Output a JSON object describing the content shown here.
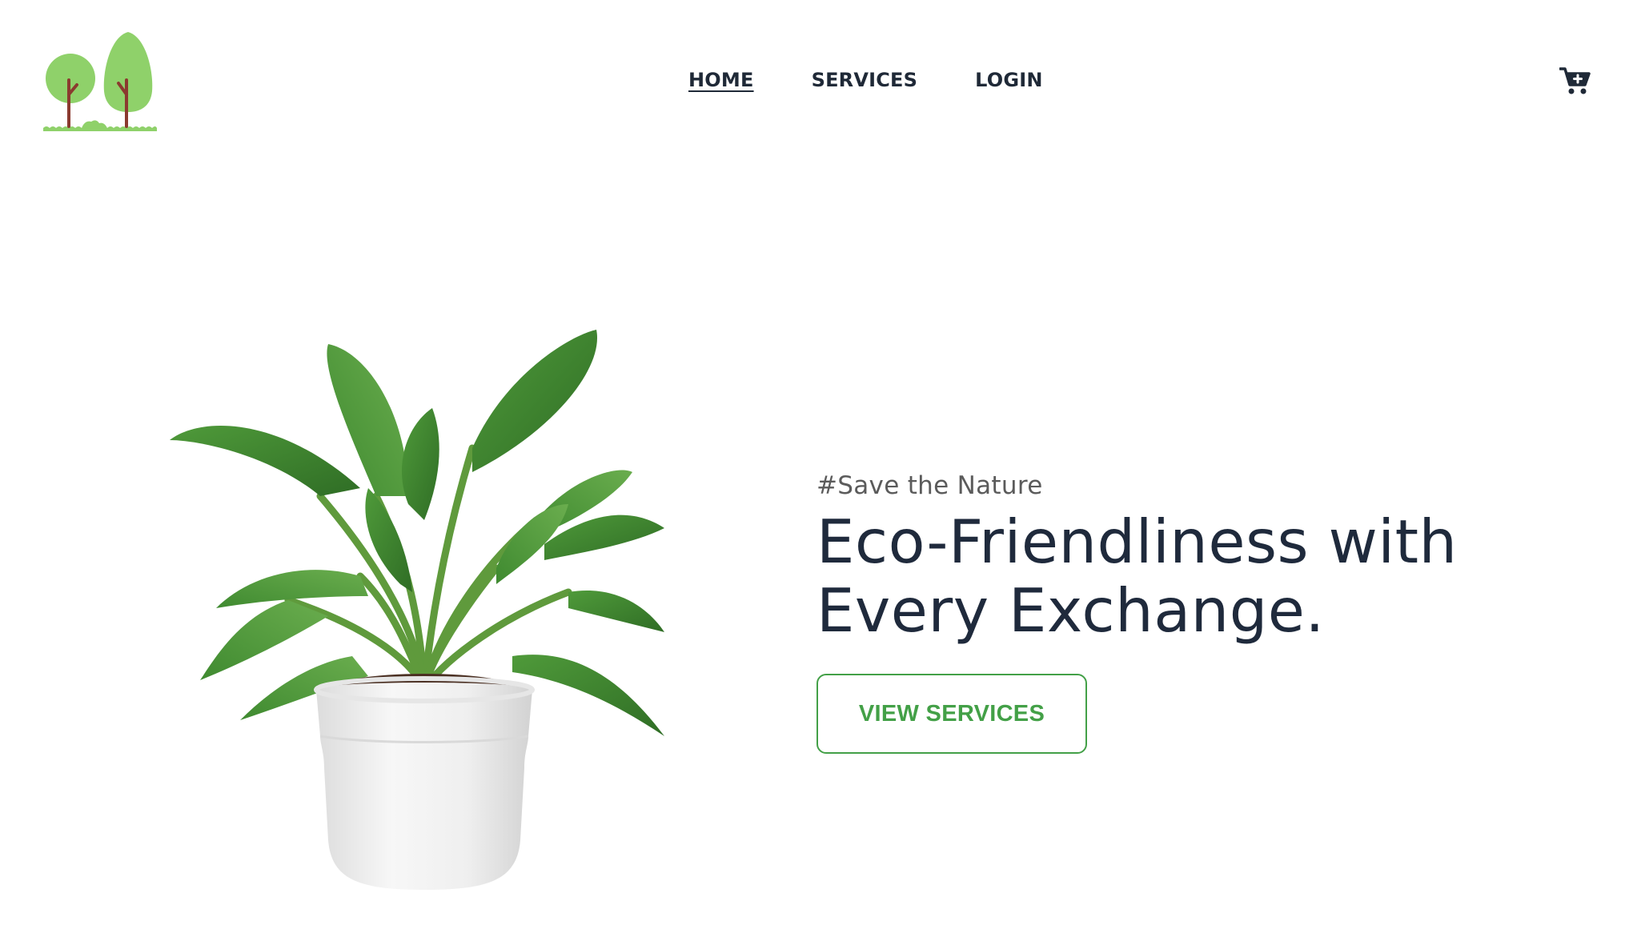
{
  "header": {
    "logo_icon": "two-trees-logo-icon",
    "nav": {
      "items": [
        {
          "label": "HOME",
          "active": true
        },
        {
          "label": "SERVICES",
          "active": false
        },
        {
          "label": "LOGIN",
          "active": false
        }
      ]
    },
    "cart_icon": "cart-plus-icon"
  },
  "hero": {
    "image": "potted-plant-image",
    "tagline": "#Save the Nature",
    "headline_line1": "Eco-Friendliness with",
    "headline_line2": "Every Exchange.",
    "cta_label": "VIEW SERVICES"
  },
  "colors": {
    "accent_green": "#43a047",
    "logo_green": "#8fd16a",
    "trunk_brown": "#8b3a2f",
    "text_dark": "#1f2a3c",
    "tagline_gray": "#5b5b5b"
  }
}
